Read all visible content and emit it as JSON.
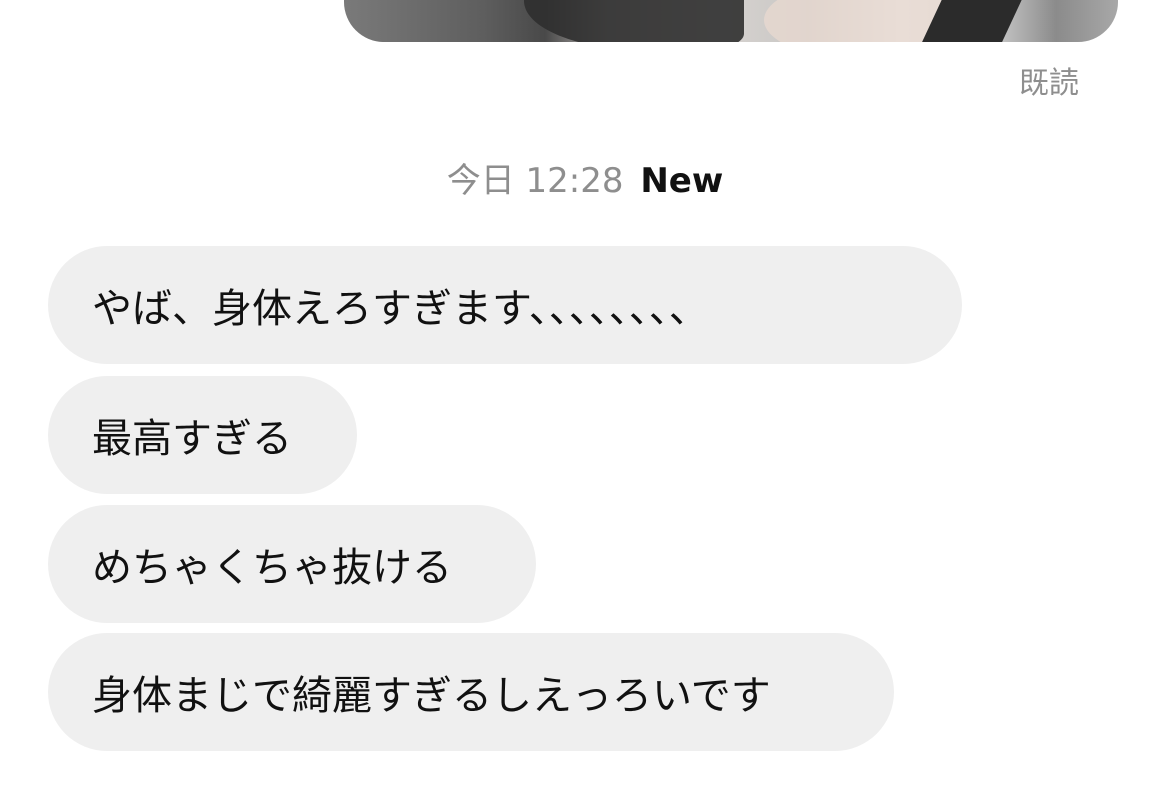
{
  "read_receipt": "既読",
  "timestamp": {
    "date_time": "今日 12:28",
    "new_label": "New"
  },
  "messages": [
    {
      "text": "やば、身体えろすぎます、、、、、、、、"
    },
    {
      "text": "最高すぎる"
    },
    {
      "text": "めちゃくちゃ抜ける"
    },
    {
      "text": "身体まじで綺麗すぎるしえっろいです"
    }
  ]
}
